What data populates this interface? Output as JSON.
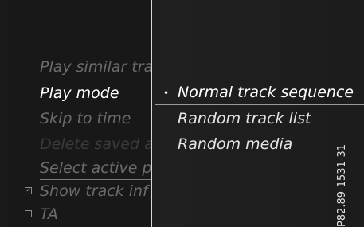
{
  "main_menu": {
    "items": [
      {
        "label": "Play similar tra",
        "state": "dim"
      },
      {
        "label": "Play mode",
        "state": "active"
      },
      {
        "label": "Skip to time",
        "state": "dim"
      },
      {
        "label": "Delete saved a",
        "state": "disabled"
      },
      {
        "label": "Select active p",
        "state": "dim"
      },
      {
        "label": "Show track inf",
        "state": "dim",
        "checkbox": "checked"
      },
      {
        "label": "TA",
        "state": "dim",
        "checkbox": "unchecked"
      }
    ]
  },
  "play_mode_submenu": {
    "options": [
      {
        "label": "Normal track sequence",
        "selected": true
      },
      {
        "label": "Random track list",
        "selected": false
      },
      {
        "label": "Random media",
        "selected": false
      }
    ],
    "bullet": "•"
  },
  "reference_code": "P82.89-1531-31",
  "colors": {
    "background": "#1b1b1b",
    "active_text": "#ffffff",
    "dim_text": "#6c6c6c",
    "divider": "#d8d8d8"
  }
}
